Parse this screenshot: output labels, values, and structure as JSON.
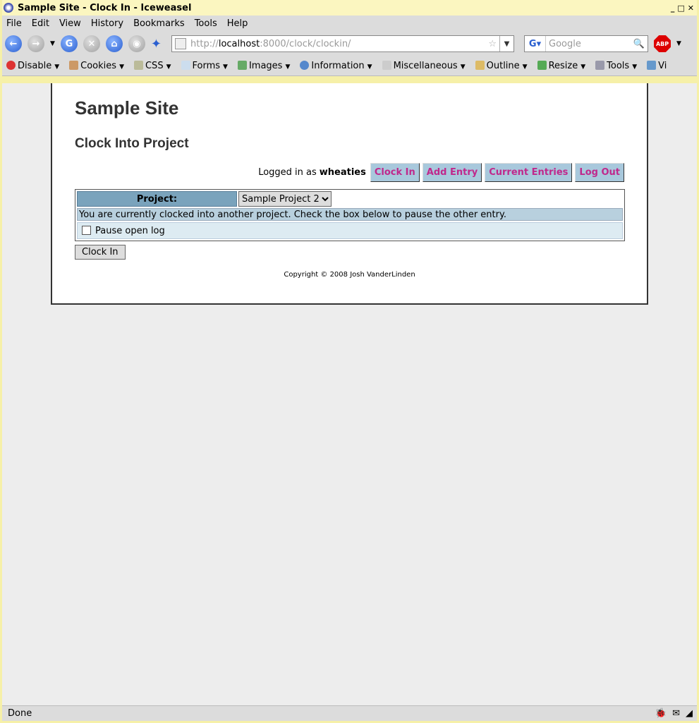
{
  "window": {
    "title": "Sample Site - Clock In - Iceweasel"
  },
  "menu": [
    "File",
    "Edit",
    "View",
    "History",
    "Bookmarks",
    "Tools",
    "Help"
  ],
  "navbar": {
    "url_scheme": "http://",
    "url_host": "localhost",
    "url_path": ":8000/clock/clockin/",
    "search_placeholder": "Google",
    "abp": "ABP"
  },
  "devbar": [
    "Disable",
    "Cookies",
    "CSS",
    "Forms",
    "Images",
    "Information",
    "Miscellaneous",
    "Outline",
    "Resize",
    "Tools",
    "Vi"
  ],
  "page": {
    "site_title": "Sample Site",
    "heading": "Clock Into Project",
    "logged_in_prefix": "Logged in as",
    "username": "wheaties",
    "nav": [
      "Clock In",
      "Add Entry",
      "Current Entries",
      "Log Out"
    ],
    "project_label": "Project:",
    "project_value": "Sample Project 2",
    "message": "You are currently clocked into another project. Check the box below to pause the other entry.",
    "pause_label": "Pause open log",
    "submit": "Clock In",
    "copyright": "Copyright © 2008 Josh VanderLinden"
  },
  "status": {
    "text": "Done"
  }
}
